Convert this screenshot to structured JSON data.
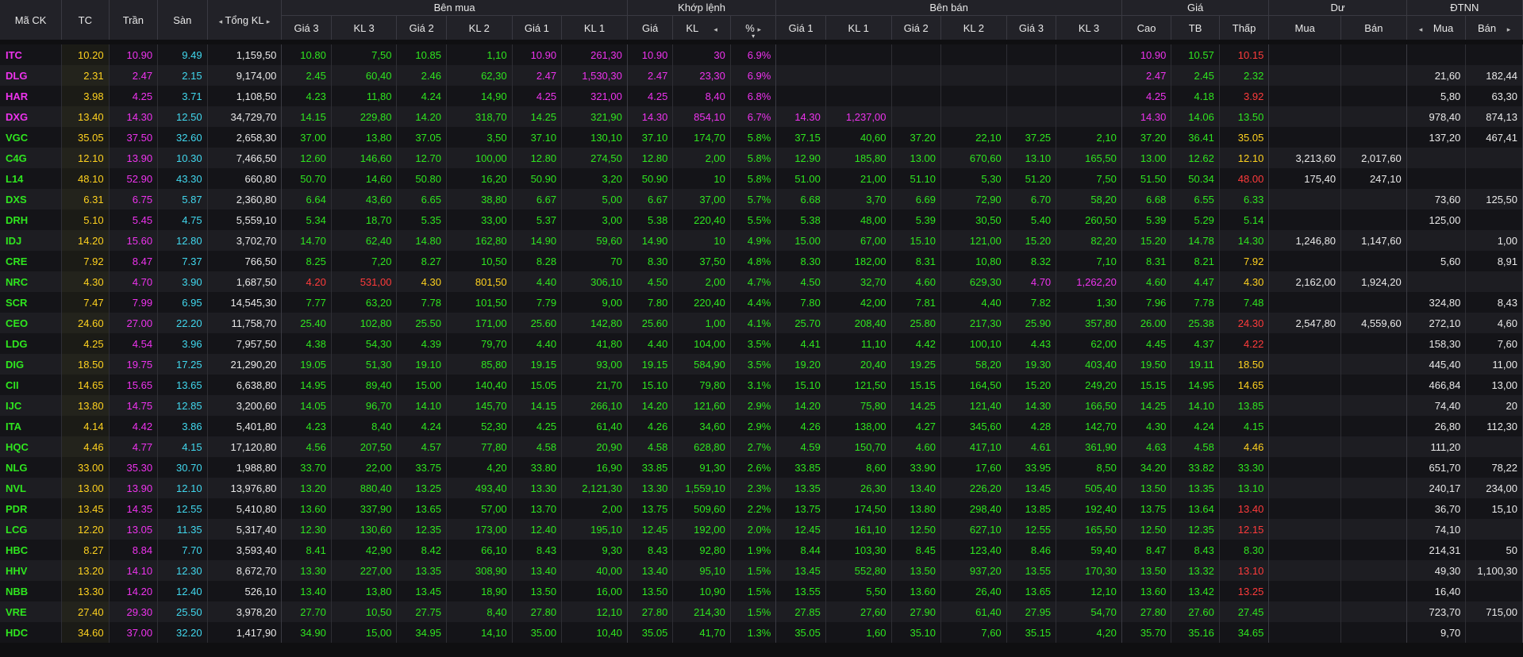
{
  "headers": {
    "symbol": "Mã CK",
    "ref": "TC",
    "ceiling": "Trần",
    "floor": "Sàn",
    "total_volume": "Tổng KL",
    "bid_group": "Bên mua",
    "match_group": "Khớp lệnh",
    "ask_group": "Bên bán",
    "price_group": "Giá",
    "remain_group": "Dư",
    "foreign_group": "ĐTNN",
    "bid": [
      "Giá 3",
      "KL 3",
      "Giá 2",
      "KL 2",
      "Giá 1",
      "KL 1"
    ],
    "match": [
      "Giá",
      "KL",
      "%"
    ],
    "ask": [
      "Giá 1",
      "KL 1",
      "Giá 2",
      "KL 2",
      "Giá 3",
      "KL 3"
    ],
    "price": [
      "Cao",
      "TB",
      "Thấp"
    ],
    "remain": [
      "Mua",
      "Bán"
    ],
    "foreign": [
      "Mua",
      "Bán"
    ],
    "arrow_left": "◂",
    "arrow_right": "▸",
    "sort_indicator": "▾"
  },
  "colors": {
    "up": "#2fe61f",
    "down": "#ff3b3b",
    "ref": "#ffd21f",
    "ceiling": "#ee33ee",
    "floor": "#41d8ee",
    "neutral": "#e9e9e9"
  },
  "rows": [
    [
      "ITC",
      "10.20",
      "10.90",
      "9.49",
      "1,159,50",
      "10.80",
      "7,50",
      "10.85",
      "1,10",
      "10.90",
      "261,30",
      "10.90",
      "30",
      "6.9%",
      "",
      "",
      "",
      "",
      "",
      "",
      "10.90",
      "10.57",
      "10.15",
      "",
      "",
      "",
      ""
    ],
    [
      "DLG",
      "2.31",
      "2.47",
      "2.15",
      "9,174,00",
      "2.45",
      "60,40",
      "2.46",
      "62,30",
      "2.47",
      "1,530,30",
      "2.47",
      "23,30",
      "6.9%",
      "",
      "",
      "",
      "",
      "",
      "",
      "2.47",
      "2.45",
      "2.32",
      "",
      "",
      "21,60",
      "182,44"
    ],
    [
      "HAR",
      "3.98",
      "4.25",
      "3.71",
      "1,108,50",
      "4.23",
      "11,80",
      "4.24",
      "14,90",
      "4.25",
      "321,00",
      "4.25",
      "8,40",
      "6.8%",
      "",
      "",
      "",
      "",
      "",
      "",
      "4.25",
      "4.18",
      "3.92",
      "",
      "",
      "5,80",
      "63,30"
    ],
    [
      "DXG",
      "13.40",
      "14.30",
      "12.50",
      "34,729,70",
      "14.15",
      "229,80",
      "14.20",
      "318,70",
      "14.25",
      "321,90",
      "14.30",
      "854,10",
      "6.7%",
      "14.30",
      "1,237,00",
      "",
      "",
      "",
      "",
      "14.30",
      "14.06",
      "13.50",
      "",
      "",
      "978,40",
      "874,13"
    ],
    [
      "VGC",
      "35.05",
      "37.50",
      "32.60",
      "2,658,30",
      "37.00",
      "13,80",
      "37.05",
      "3,50",
      "37.10",
      "130,10",
      "37.10",
      "174,70",
      "5.8%",
      "37.15",
      "40,60",
      "37.20",
      "22,10",
      "37.25",
      "2,10",
      "37.20",
      "36.41",
      "35.05",
      "",
      "",
      "137,20",
      "467,41"
    ],
    [
      "C4G",
      "12.10",
      "13.90",
      "10.30",
      "7,466,50",
      "12.60",
      "146,60",
      "12.70",
      "100,00",
      "12.80",
      "274,50",
      "12.80",
      "2,00",
      "5.8%",
      "12.90",
      "185,80",
      "13.00",
      "670,60",
      "13.10",
      "165,50",
      "13.00",
      "12.62",
      "12.10",
      "3,213,60",
      "2,017,60",
      "",
      ""
    ],
    [
      "L14",
      "48.10",
      "52.90",
      "43.30",
      "660,80",
      "50.70",
      "14,60",
      "50.80",
      "16,20",
      "50.90",
      "3,20",
      "50.90",
      "10",
      "5.8%",
      "51.00",
      "21,00",
      "51.10",
      "5,30",
      "51.20",
      "7,50",
      "51.50",
      "50.34",
      "48.00",
      "175,40",
      "247,10",
      "",
      ""
    ],
    [
      "DXS",
      "6.31",
      "6.75",
      "5.87",
      "2,360,80",
      "6.64",
      "43,60",
      "6.65",
      "38,80",
      "6.67",
      "5,00",
      "6.67",
      "37,00",
      "5.7%",
      "6.68",
      "3,70",
      "6.69",
      "72,90",
      "6.70",
      "58,20",
      "6.68",
      "6.55",
      "6.33",
      "",
      "",
      "73,60",
      "125,50"
    ],
    [
      "DRH",
      "5.10",
      "5.45",
      "4.75",
      "5,559,10",
      "5.34",
      "18,70",
      "5.35",
      "33,00",
      "5.37",
      "3,00",
      "5.38",
      "220,40",
      "5.5%",
      "5.38",
      "48,00",
      "5.39",
      "30,50",
      "5.40",
      "260,50",
      "5.39",
      "5.29",
      "5.14",
      "",
      "",
      "125,00",
      ""
    ],
    [
      "IDJ",
      "14.20",
      "15.60",
      "12.80",
      "3,702,70",
      "14.70",
      "62,40",
      "14.80",
      "162,80",
      "14.90",
      "59,60",
      "14.90",
      "10",
      "4.9%",
      "15.00",
      "67,00",
      "15.10",
      "121,00",
      "15.20",
      "82,20",
      "15.20",
      "14.78",
      "14.30",
      "1,246,80",
      "1,147,60",
      "",
      "1,00"
    ],
    [
      "CRE",
      "7.92",
      "8.47",
      "7.37",
      "766,50",
      "8.25",
      "7,20",
      "8.27",
      "10,50",
      "8.28",
      "70",
      "8.30",
      "37,50",
      "4.8%",
      "8.30",
      "182,00",
      "8.31",
      "10,80",
      "8.32",
      "7,10",
      "8.31",
      "8.21",
      "7.92",
      "",
      "",
      "5,60",
      "8,91"
    ],
    [
      "NRC",
      "4.30",
      "4.70",
      "3.90",
      "1,687,50",
      "4.20",
      "531,00",
      "4.30",
      "801,50",
      "4.40",
      "306,10",
      "4.50",
      "2,00",
      "4.7%",
      "4.50",
      "32,70",
      "4.60",
      "629,30",
      "4.70",
      "1,262,20",
      "4.60",
      "4.47",
      "4.30",
      "2,162,00",
      "1,924,20",
      "",
      ""
    ],
    [
      "SCR",
      "7.47",
      "7.99",
      "6.95",
      "14,545,30",
      "7.77",
      "63,20",
      "7.78",
      "101,50",
      "7.79",
      "9,00",
      "7.80",
      "220,40",
      "4.4%",
      "7.80",
      "42,00",
      "7.81",
      "4,40",
      "7.82",
      "1,30",
      "7.96",
      "7.78",
      "7.48",
      "",
      "",
      "324,80",
      "8,43"
    ],
    [
      "CEO",
      "24.60",
      "27.00",
      "22.20",
      "11,758,70",
      "25.40",
      "102,80",
      "25.50",
      "171,00",
      "25.60",
      "142,80",
      "25.60",
      "1,00",
      "4.1%",
      "25.70",
      "208,40",
      "25.80",
      "217,30",
      "25.90",
      "357,80",
      "26.00",
      "25.38",
      "24.30",
      "2,547,80",
      "4,559,60",
      "272,10",
      "4,60"
    ],
    [
      "LDG",
      "4.25",
      "4.54",
      "3.96",
      "7,957,50",
      "4.38",
      "54,30",
      "4.39",
      "79,70",
      "4.40",
      "41,80",
      "4.40",
      "104,00",
      "3.5%",
      "4.41",
      "11,10",
      "4.42",
      "100,10",
      "4.43",
      "62,00",
      "4.45",
      "4.37",
      "4.22",
      "",
      "",
      "158,30",
      "7,60"
    ],
    [
      "DIG",
      "18.50",
      "19.75",
      "17.25",
      "21,290,20",
      "19.05",
      "51,30",
      "19.10",
      "85,80",
      "19.15",
      "93,00",
      "19.15",
      "584,90",
      "3.5%",
      "19.20",
      "20,40",
      "19.25",
      "58,20",
      "19.30",
      "403,40",
      "19.50",
      "19.11",
      "18.50",
      "",
      "",
      "445,40",
      "11,00"
    ],
    [
      "CII",
      "14.65",
      "15.65",
      "13.65",
      "6,638,80",
      "14.95",
      "89,40",
      "15.00",
      "140,40",
      "15.05",
      "21,70",
      "15.10",
      "79,80",
      "3.1%",
      "15.10",
      "121,50",
      "15.15",
      "164,50",
      "15.20",
      "249,20",
      "15.15",
      "14.95",
      "14.65",
      "",
      "",
      "466,84",
      "13,00"
    ],
    [
      "IJC",
      "13.80",
      "14.75",
      "12.85",
      "3,200,60",
      "14.05",
      "96,70",
      "14.10",
      "145,70",
      "14.15",
      "266,10",
      "14.20",
      "121,60",
      "2.9%",
      "14.20",
      "75,80",
      "14.25",
      "121,40",
      "14.30",
      "166,50",
      "14.25",
      "14.10",
      "13.85",
      "",
      "",
      "74,40",
      "20"
    ],
    [
      "ITA",
      "4.14",
      "4.42",
      "3.86",
      "5,401,80",
      "4.23",
      "8,40",
      "4.24",
      "52,30",
      "4.25",
      "61,40",
      "4.26",
      "34,60",
      "2.9%",
      "4.26",
      "138,00",
      "4.27",
      "345,60",
      "4.28",
      "142,70",
      "4.30",
      "4.24",
      "4.15",
      "",
      "",
      "26,80",
      "112,30"
    ],
    [
      "HQC",
      "4.46",
      "4.77",
      "4.15",
      "17,120,80",
      "4.56",
      "207,50",
      "4.57",
      "77,80",
      "4.58",
      "20,90",
      "4.58",
      "628,80",
      "2.7%",
      "4.59",
      "150,70",
      "4.60",
      "417,10",
      "4.61",
      "361,90",
      "4.63",
      "4.58",
      "4.46",
      "",
      "",
      "111,20",
      ""
    ],
    [
      "NLG",
      "33.00",
      "35.30",
      "30.70",
      "1,988,80",
      "33.70",
      "22,00",
      "33.75",
      "4,20",
      "33.80",
      "16,90",
      "33.85",
      "91,30",
      "2.6%",
      "33.85",
      "8,60",
      "33.90",
      "17,60",
      "33.95",
      "8,50",
      "34.20",
      "33.82",
      "33.30",
      "",
      "",
      "651,70",
      "78,22"
    ],
    [
      "NVL",
      "13.00",
      "13.90",
      "12.10",
      "13,976,80",
      "13.20",
      "880,40",
      "13.25",
      "493,40",
      "13.30",
      "2,121,30",
      "13.30",
      "1,559,10",
      "2.3%",
      "13.35",
      "26,30",
      "13.40",
      "226,20",
      "13.45",
      "505,40",
      "13.50",
      "13.35",
      "13.10",
      "",
      "",
      "240,17",
      "234,00"
    ],
    [
      "PDR",
      "13.45",
      "14.35",
      "12.55",
      "5,410,80",
      "13.60",
      "337,90",
      "13.65",
      "57,00",
      "13.70",
      "2,00",
      "13.75",
      "509,60",
      "2.2%",
      "13.75",
      "174,50",
      "13.80",
      "298,40",
      "13.85",
      "192,40",
      "13.75",
      "13.64",
      "13.40",
      "",
      "",
      "36,70",
      "15,10"
    ],
    [
      "LCG",
      "12.20",
      "13.05",
      "11.35",
      "5,317,40",
      "12.30",
      "130,60",
      "12.35",
      "173,00",
      "12.40",
      "195,10",
      "12.45",
      "192,00",
      "2.0%",
      "12.45",
      "161,10",
      "12.50",
      "627,10",
      "12.55",
      "165,50",
      "12.50",
      "12.35",
      "12.15",
      "",
      "",
      "74,10",
      ""
    ],
    [
      "HBC",
      "8.27",
      "8.84",
      "7.70",
      "3,593,40",
      "8.41",
      "42,90",
      "8.42",
      "66,10",
      "8.43",
      "9,30",
      "8.43",
      "92,80",
      "1.9%",
      "8.44",
      "103,30",
      "8.45",
      "123,40",
      "8.46",
      "59,40",
      "8.47",
      "8.43",
      "8.30",
      "",
      "",
      "214,31",
      "50"
    ],
    [
      "HHV",
      "13.20",
      "14.10",
      "12.30",
      "8,672,70",
      "13.30",
      "227,00",
      "13.35",
      "308,90",
      "13.40",
      "40,00",
      "13.40",
      "95,10",
      "1.5%",
      "13.45",
      "552,80",
      "13.50",
      "937,20",
      "13.55",
      "170,30",
      "13.50",
      "13.32",
      "13.10",
      "",
      "",
      "49,30",
      "1,100,30"
    ],
    [
      "NBB",
      "13.30",
      "14.20",
      "12.40",
      "526,10",
      "13.40",
      "13,80",
      "13.45",
      "18,90",
      "13.50",
      "16,00",
      "13.50",
      "10,90",
      "1.5%",
      "13.55",
      "5,50",
      "13.60",
      "26,40",
      "13.65",
      "12,10",
      "13.60",
      "13.42",
      "13.25",
      "",
      "",
      "16,40",
      ""
    ],
    [
      "VRE",
      "27.40",
      "29.30",
      "25.50",
      "3,978,20",
      "27.70",
      "10,50",
      "27.75",
      "8,40",
      "27.80",
      "12,10",
      "27.80",
      "214,30",
      "1.5%",
      "27.85",
      "27,60",
      "27.90",
      "61,40",
      "27.95",
      "54,70",
      "27.80",
      "27.60",
      "27.45",
      "",
      "",
      "723,70",
      "715,00"
    ],
    [
      "HDC",
      "34.60",
      "37.00",
      "32.20",
      "1,417,90",
      "34.90",
      "15,00",
      "34.95",
      "14,10",
      "35.00",
      "10,40",
      "35.05",
      "41,70",
      "1.3%",
      "35.05",
      "1,60",
      "35.10",
      "7,60",
      "35.15",
      "4,20",
      "35.70",
      "35.16",
      "34.65",
      "",
      "",
      "9,70",
      ""
    ]
  ]
}
